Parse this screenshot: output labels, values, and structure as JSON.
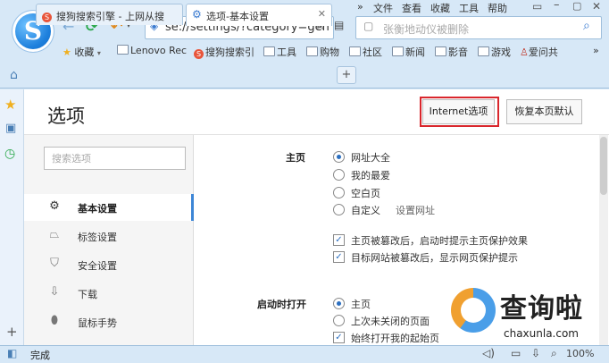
{
  "menu": {
    "chevron": "»",
    "items": [
      "文件",
      "查看",
      "收藏",
      "工具",
      "帮助"
    ]
  },
  "toolbar": {
    "address_text": "se://settings/?category=gen",
    "search_placeholder": "张衡地动仪被删除"
  },
  "bookmarks": {
    "favorites_label": "收藏",
    "items": [
      "Lenovo Rec",
      "搜狗搜索引",
      "工具",
      "购物",
      "社区",
      "新闻",
      "影音",
      "游戏",
      "爱问共"
    ],
    "more": "»"
  },
  "tabs": {
    "items": [
      {
        "label": "搜狗搜索引擎 - 上网从搜"
      },
      {
        "label": "选项-基本设置"
      }
    ],
    "new_tab": "+"
  },
  "settings": {
    "title": "选项",
    "internet_options_label": "Internet选项",
    "restore_default_label": "恢复本页默认",
    "search_placeholder": "搜索选项",
    "sidebar_items": [
      {
        "icon": "gear-icon",
        "label": "基本设置"
      },
      {
        "icon": "tag-icon",
        "label": "标签设置"
      },
      {
        "icon": "shield-icon",
        "label": "安全设置"
      },
      {
        "icon": "download-icon",
        "label": "下载"
      },
      {
        "icon": "mouse-icon",
        "label": "鼠标手势"
      }
    ],
    "home_section": {
      "label": "主页",
      "options": [
        "网址大全",
        "我的最爱",
        "空白页",
        "自定义"
      ],
      "selected_index": 0,
      "custom_link": "设置网址",
      "checks": [
        {
          "label": "主页被篡改后，启动时提示主页保护效果",
          "checked": true
        },
        {
          "label": "目标网站被篡改后，显示网页保护提示",
          "checked": true
        }
      ]
    },
    "startup_section": {
      "label": "启动时打开",
      "options": [
        "主页",
        "上次未关闭的页面"
      ],
      "selected_index": 0,
      "checks": [
        {
          "label": "始终打开我的起始页",
          "checked": true
        }
      ]
    }
  },
  "watermark": {
    "text": "查询啦",
    "sub": "chaxunla.com"
  },
  "status": {
    "text": "完成",
    "zoom": "100%"
  }
}
